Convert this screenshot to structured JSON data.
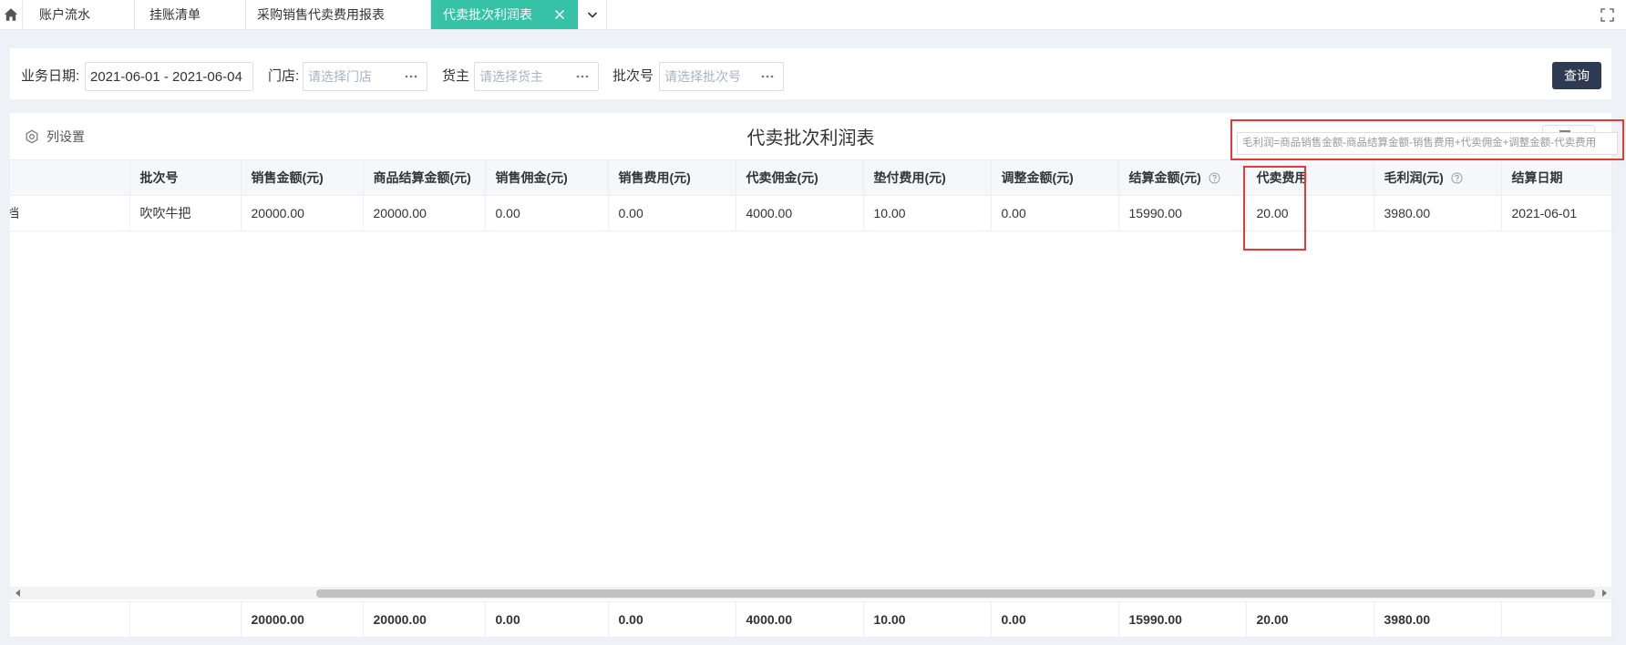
{
  "tabs": [
    {
      "label": "账户流水"
    },
    {
      "label": "挂账清单"
    },
    {
      "label": "采购销售代卖费用报表"
    },
    {
      "label": "代卖批次利润表",
      "active": true
    }
  ],
  "filters": {
    "date_label": "业务日期:",
    "date_value": "2021-06-01 - 2021-06-04",
    "store_label": "门店:",
    "store_placeholder": "请选择门店",
    "owner_label": "货主",
    "owner_placeholder": "请选择货主",
    "batch_label": "批次号",
    "batch_placeholder": "请选择批次号",
    "query_button": "查询"
  },
  "report": {
    "column_settings_label": "列设置",
    "title": "代卖批次利润表",
    "formula_tooltip": "毛利润=商品销售金额-商品结算金额-销售费用+代卖佣金+调整金额-代卖费用"
  },
  "table": {
    "columns": [
      {
        "label": ""
      },
      {
        "label": "批次号"
      },
      {
        "label": "销售金额(元)"
      },
      {
        "label": "商品结算金额(元)"
      },
      {
        "label": "销售佣金(元)"
      },
      {
        "label": "销售费用(元)"
      },
      {
        "label": "代卖佣金(元)"
      },
      {
        "label": "垫付费用(元)"
      },
      {
        "label": "调整金额(元)"
      },
      {
        "label": "结算金额(元)",
        "icon": "help-circle-icon"
      },
      {
        "label": "代卖费用"
      },
      {
        "label": "毛利润(元)",
        "icon": "help-circle-icon"
      },
      {
        "label": "结算日期"
      }
    ],
    "rows": [
      [
        "档",
        "吹吹牛把",
        "20000.00",
        "20000.00",
        "0.00",
        "0.00",
        "4000.00",
        "10.00",
        "0.00",
        "15990.00",
        "20.00",
        "3980.00",
        "2021-06-01"
      ]
    ],
    "footer": [
      "",
      "",
      "20000.00",
      "20000.00",
      "0.00",
      "0.00",
      "4000.00",
      "10.00",
      "0.00",
      "15990.00",
      "20.00",
      "3980.00",
      ""
    ]
  },
  "icons": {
    "home": "home-icon",
    "tab_close": "close-icon",
    "tab_menu": "chevron-down-icon",
    "fullscreen": "fullscreen-icon",
    "input_more": "ellipsis-icon",
    "column_settings": "gear-icon",
    "toolbar_action": "menu-lines-icon",
    "help": "help-circle-icon",
    "scroll_left": "arrow-left-icon",
    "scroll_right": "arrow-right-icon"
  },
  "colors": {
    "page_bg": "#eef1f5",
    "active_tab": "#36c2a6",
    "query_button": "#2d3a52",
    "header_bg": "#f5f7fa",
    "annotation_red": "#e53935"
  }
}
